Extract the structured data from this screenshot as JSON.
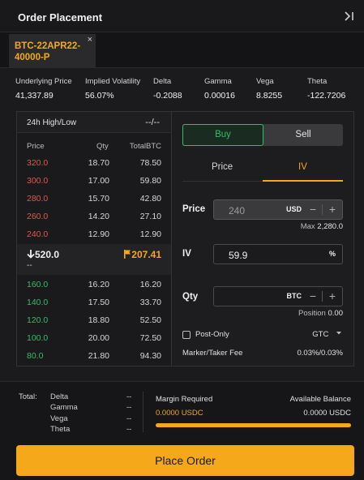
{
  "header": {
    "title": "Order Placement",
    "collapse_icon": "collapse-right-icon"
  },
  "tab": {
    "label": "BTC-22APR22-40000-P",
    "close": "×"
  },
  "greeks": [
    {
      "label": "Underlying Price",
      "value": "41,337.89"
    },
    {
      "label": "Implied Volatility",
      "value": "56.07%"
    },
    {
      "label": "Delta",
      "value": "-0.2088"
    },
    {
      "label": "Gamma",
      "value": "0.00016"
    },
    {
      "label": "Vega",
      "value": "8.8255"
    },
    {
      "label": "Theta",
      "value": "-122.7206"
    }
  ],
  "book": {
    "hl_label": "24h High/Low",
    "hl_value": "--/--",
    "headers": {
      "price": "Price",
      "qty": "Qty",
      "total": "TotalBTC"
    },
    "asks": [
      {
        "price": "320.0",
        "qty": "18.70",
        "total": "78.50"
      },
      {
        "price": "300.0",
        "qty": "17.00",
        "total": "59.80"
      },
      {
        "price": "280.0",
        "qty": "15.70",
        "total": "42.80"
      },
      {
        "price": "260.0",
        "qty": "14.20",
        "total": "27.10"
      },
      {
        "price": "240.0",
        "qty": "12.90",
        "total": "12.90"
      }
    ],
    "mark_price": "520.0",
    "mark_sub": "--",
    "last_price": "207.41",
    "bids": [
      {
        "price": "160.0",
        "qty": "16.20",
        "total": "16.20"
      },
      {
        "price": "140.0",
        "qty": "17.50",
        "total": "33.70"
      },
      {
        "price": "120.0",
        "qty": "18.80",
        "total": "52.50"
      },
      {
        "price": "100.0",
        "qty": "20.00",
        "total": "72.50"
      },
      {
        "price": "80.0",
        "qty": "21.80",
        "total": "94.30"
      }
    ]
  },
  "form": {
    "buy": "Buy",
    "sell": "Sell",
    "tab_price": "Price",
    "tab_iv": "IV",
    "price_label": "Price",
    "price_value": "240",
    "price_unit": "USD",
    "max_label": "Max",
    "max_value": "2,280.0",
    "iv_label": "IV",
    "iv_value": "59.9",
    "iv_unit": "%",
    "qty_label": "Qty",
    "qty_unit": "BTC",
    "position_label": "Position",
    "position_value": "0.00",
    "post_only": "Post-Only",
    "tif": "GTC",
    "fee_label": "Marker/Taker Fee",
    "fee_value": "0.03%/0.03%"
  },
  "footer": {
    "total_label": "Total:",
    "rows": [
      {
        "label": "Delta",
        "value": "--"
      },
      {
        "label": "Gamma",
        "value": "--"
      },
      {
        "label": "Vega",
        "value": "--"
      },
      {
        "label": "Theta",
        "value": "--"
      }
    ],
    "margin_label": "Margin Required",
    "margin_value": "0.0000 USDC",
    "balance_label": "Available Balance",
    "balance_value": "0.0000 USDC",
    "place_order": "Place Order"
  },
  "colors": {
    "accent": "#f4a81a",
    "buy": "#2fbf6a",
    "sell": "#e2574c"
  }
}
